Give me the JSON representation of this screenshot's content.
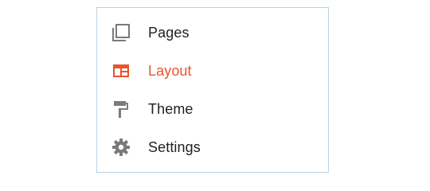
{
  "menu": {
    "items": [
      {
        "label": "Pages",
        "icon": "pages-icon",
        "active": false
      },
      {
        "label": "Layout",
        "icon": "layout-icon",
        "active": true
      },
      {
        "label": "Theme",
        "icon": "theme-icon",
        "active": false
      },
      {
        "label": "Settings",
        "icon": "settings-icon",
        "active": false
      }
    ]
  },
  "colors": {
    "accent": "#e8542b",
    "icon": "#7a7a7a",
    "text": "#212121",
    "border": "#b9d3e6"
  }
}
